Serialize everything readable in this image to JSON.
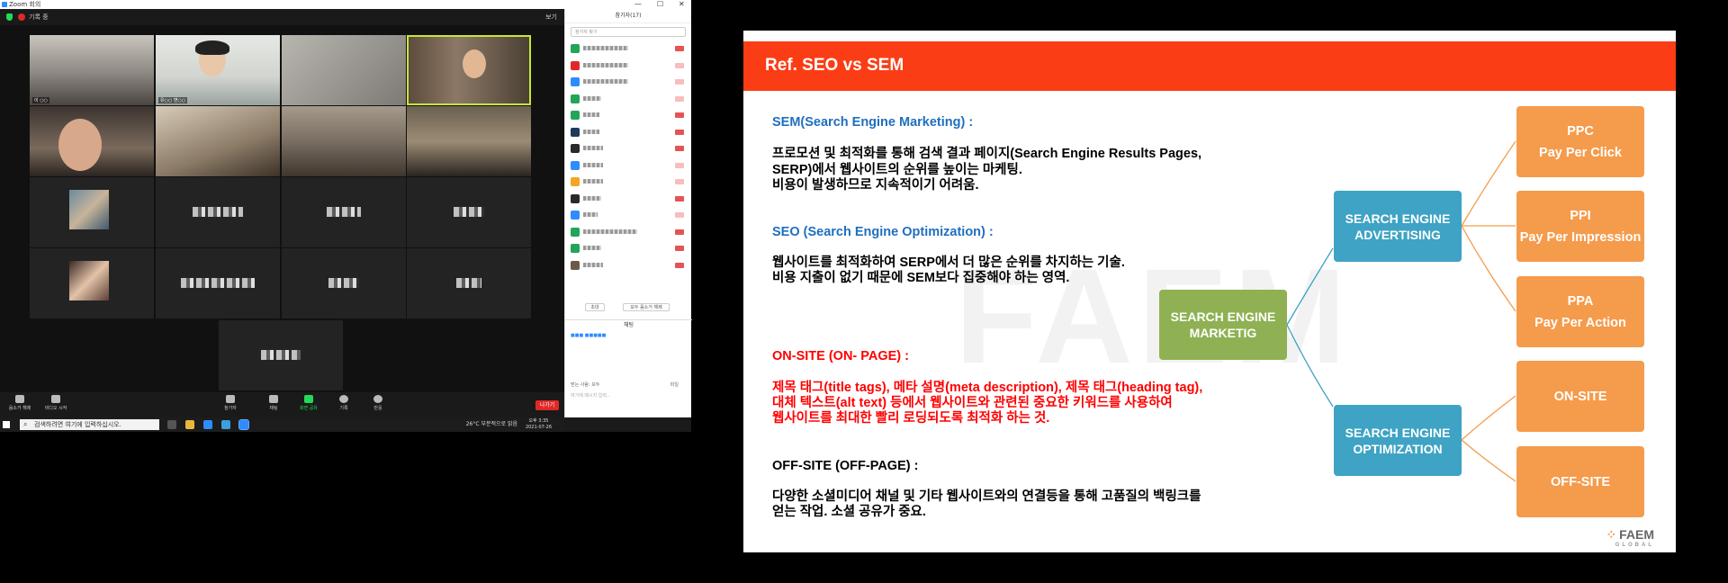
{
  "zoom": {
    "window_title": "Zoom 회의",
    "recording_label": "기록 중",
    "view_label": "보기",
    "tiles": [
      {
        "name": "이 ○○"
      },
      {
        "name": "유○○ 변○○"
      },
      {
        "name": ""
      },
      {
        "name": ""
      },
      {
        "name": ""
      },
      {
        "name": ""
      },
      {
        "name": ""
      },
      {
        "name": ""
      },
      {
        "name": ""
      },
      {
        "name": ""
      },
      {
        "name": ""
      },
      {
        "name": ""
      },
      {
        "name": ""
      },
      {
        "name": ""
      },
      {
        "name": ""
      },
      {
        "name": ""
      },
      {
        "name": ""
      }
    ],
    "controls": [
      {
        "label": "음소거 해제"
      },
      {
        "label": "비디오 시작"
      },
      {
        "label": "참가자"
      },
      {
        "label": "채팅"
      },
      {
        "label": "화면 공유"
      },
      {
        "label": "기록"
      },
      {
        "label": "반응"
      }
    ],
    "leave_label": "나가기",
    "participants_panel": {
      "title": "참가자(17)",
      "search_placeholder": "참가자 찾기",
      "invite_label": "초대",
      "mute_all_label": "모두 음소거 해제"
    },
    "chat": {
      "title": "채팅",
      "sample_message": "■■■ ■■■■■",
      "to_label": "받는 사람:",
      "to_value": "모두",
      "file_label": "파일",
      "input_placeholder": "여기에 메시지 입력..."
    }
  },
  "taskbar": {
    "search_placeholder": "검색하려면 여기에 입력하십시오.",
    "weather": "26°C 부분적으로 맑음",
    "time": "오후 3:35",
    "date": "2021-07-26"
  },
  "slide": {
    "title": "Ref.  SEO vs SEM",
    "watermark": "FAEM",
    "sem_heading": "SEM(Search Engine Marketing) :",
    "sem_line1": "프로모션 및 최적화를 통해 검색 결과 페이지(Search Engine Results Pages,",
    "sem_line2": "SERP)에서 웹사이트의 순위를 높이는 마케팅.",
    "sem_line3": "비용이 발생하므로 지속적이기 어려움.",
    "seo_heading": "SEO (Search Engine Optimization) :",
    "seo_line1": "웹사이트를 최적화하여 SERP에서 더 많은 순위를 차지하는 기술.",
    "seo_line2": "비용 지출이 없기 때문에 SEM보다 집중해야 하는 영역.",
    "onsite_heading": "ON-SITE (ON- PAGE) :",
    "onsite_line1": "제목 태그(title tags), 메타 설명(meta description), 제목 태그(heading tag),",
    "onsite_line2": "대체 텍스트(alt text) 등에서 웹사이트와 관련된 중요한 키워드를 사용하여",
    "onsite_line3": "웹사이트를 최대한 빨리 로딩되도록 최적화 하는 것.",
    "offsite_heading": "OFF-SITE (OFF-PAGE) :",
    "offsite_line1": "다양한 소셜미디어 채널 및 기타 웹사이트와의 연결등을 통해 고품질의 백링크를",
    "offsite_line2": "얻는 작업. 소셜 공유가 중요.",
    "diagram": {
      "root": "SEARCH ENGINE MARKETIG",
      "sea": "SEARCH ENGINE ADVERTISING",
      "seo": "SEARCH ENGINE OPTIMIZATION",
      "ppc_title": "PPC",
      "ppc_sub": "Pay Per Click",
      "ppi_title": "PPI",
      "ppi_sub": "Pay Per Impression",
      "ppa_title": "PPA",
      "ppa_sub": "Pay Per Action",
      "onsite": "ON-SITE",
      "offsite": "OFF-SITE"
    },
    "logo_text": "FAEM",
    "logo_sub": "GLOBAL",
    "colors": {
      "header": "#fb3d15",
      "blue_text": "#1f6fbf",
      "red_text": "#ff0000",
      "green_box": "#8fb153",
      "blue_box": "#3ea3c4",
      "orange_box": "#f59b4c"
    }
  }
}
